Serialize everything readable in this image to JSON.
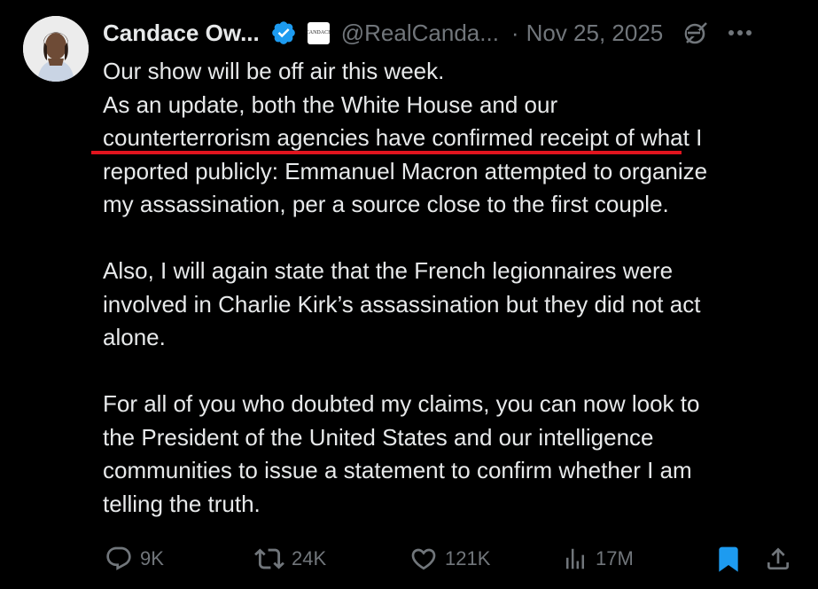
{
  "author": {
    "name": "Candace Ow...",
    "handle": "@RealCanda...",
    "affiliation_badge_text": "CANDACE",
    "verified_icon": "verified-badge-icon"
  },
  "tweet": {
    "separator": "·",
    "date": "Nov 25, 2025",
    "lines": [
      "Our show will be off air this week.",
      "As an update, both the White House and our",
      "counterterrorism agencies have confirmed receipt of what I",
      "reported publicly: Emmanuel Macron attempted to organize",
      "my assassination, per a source close to the first couple.",
      "",
      "Also, I will again state that the French legionnaires were",
      "involved in Charlie Kirk’s assassination but they did not act",
      "alone.",
      "",
      "For all of you who doubted my claims, you can now look to",
      "the President of the United States and our intelligence",
      "communities to issue a statement to confirm whether I am",
      "telling the truth."
    ],
    "annotation_color": "#e0141e"
  },
  "actions": {
    "replies": "9K",
    "reposts": "24K",
    "likes": "121K",
    "views": "17M"
  },
  "colors": {
    "background": "#000000",
    "text": "#e7e9ea",
    "muted": "#71767b",
    "accent": "#1d9bf0"
  }
}
